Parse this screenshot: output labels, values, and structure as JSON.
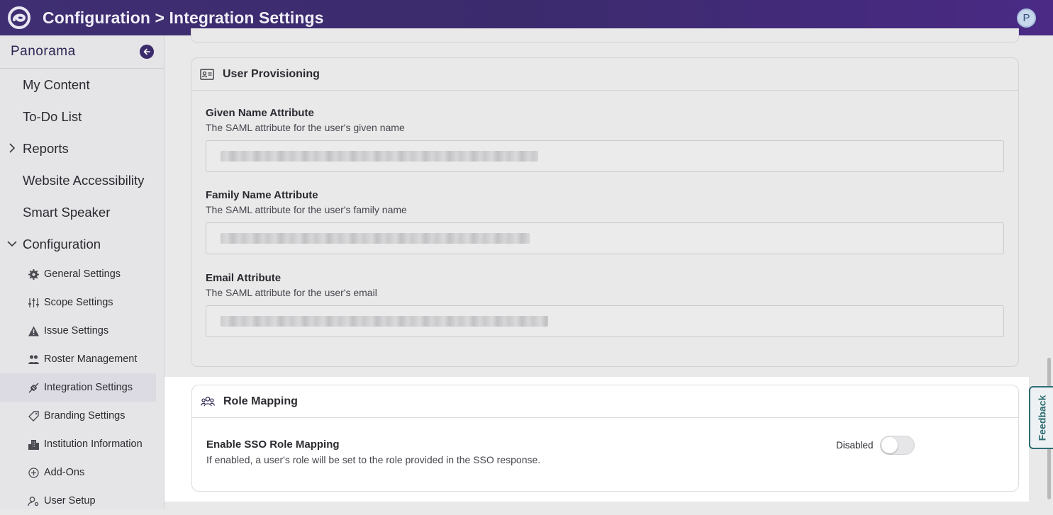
{
  "header": {
    "title": "Configuration > Integration Settings",
    "avatar_initial": "P",
    "logo_icon": "swirl-logo-icon"
  },
  "sidebar": {
    "title": "Panorama",
    "collapse_icon": "arrow-left-circle-icon",
    "items": [
      {
        "label": "My Content"
      },
      {
        "label": "To-Do List"
      },
      {
        "label": "Reports",
        "expandable": true,
        "expanded": false
      },
      {
        "label": "Website Accessibility"
      },
      {
        "label": "Smart Speaker"
      },
      {
        "label": "Configuration",
        "expandable": true,
        "expanded": true
      }
    ],
    "sub_items": [
      {
        "label": "General Settings",
        "icon": "gear-icon"
      },
      {
        "label": "Scope Settings",
        "icon": "sliders-icon"
      },
      {
        "label": "Issue Settings",
        "icon": "warning-icon"
      },
      {
        "label": "Roster Management",
        "icon": "people-icon"
      },
      {
        "label": "Integration Settings",
        "icon": "plug-icon",
        "active": true
      },
      {
        "label": "Branding Settings",
        "icon": "tag-icon"
      },
      {
        "label": "Institution Information",
        "icon": "building-icon"
      },
      {
        "label": "Add-Ons",
        "icon": "plus-circle-icon"
      },
      {
        "label": "User Setup",
        "icon": "user-gear-icon"
      }
    ]
  },
  "provisioning": {
    "title": "User Provisioning",
    "icon": "id-card-icon",
    "fields": [
      {
        "label": "Given Name Attribute",
        "description": "The SAML attribute for the user's given name",
        "value": ""
      },
      {
        "label": "Family Name Attribute",
        "description": "The SAML attribute for the user's family name",
        "value": ""
      },
      {
        "label": "Email Attribute",
        "description": "The SAML attribute for the user's email",
        "value": ""
      }
    ]
  },
  "role_mapping": {
    "title": "Role Mapping",
    "icon": "group-icon",
    "setting_label": "Enable SSO Role Mapping",
    "setting_description": "If enabled, a user's role will be set to the role provided in the SSO response.",
    "toggle_state_text": "Disabled",
    "enabled": false
  },
  "feedback": {
    "label": "Feedback"
  }
}
